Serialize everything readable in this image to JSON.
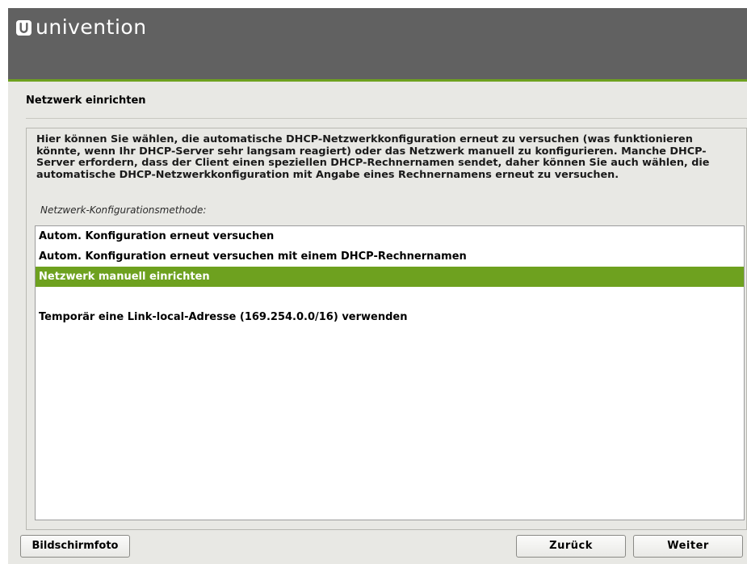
{
  "brand": {
    "name": "univention"
  },
  "page": {
    "title": "Netzwerk einrichten"
  },
  "content": {
    "description": "Hier können Sie wählen, die automatische DHCP-Netzwerkkonfiguration erneut zu versuchen (was funktionieren könnte, wenn Ihr DHCP-Server sehr langsam reagiert) oder das Netzwerk manuell zu konfigurieren. Manche DHCP-Server erfordern, dass der Client einen speziellen DHCP-Rechnernamen sendet, daher können Sie auch wählen, die automatische DHCP-Netzwerkkonfiguration mit Angabe eines Rechnernamens erneut zu versuchen.",
    "question": "Netzwerk-Konfigurationsmethode:"
  },
  "options": [
    {
      "label": "Autom. Konfiguration erneut versuchen",
      "selected": false
    },
    {
      "label": "Autom. Konfiguration erneut versuchen mit einem DHCP-Rechnernamen",
      "selected": false
    },
    {
      "label": "Netzwerk manuell einrichten",
      "selected": true
    },
    {
      "label": "",
      "selected": false
    },
    {
      "label": "Temporär eine Link-local-Adresse (169.254.0.0/16) verwenden",
      "selected": false
    }
  ],
  "buttons": {
    "screenshot": "Bildschirmfoto",
    "back": "Zurück",
    "next": "Weiter"
  },
  "colors": {
    "header_background": "#616161",
    "accent": "#6ea11f",
    "window_background": "#e8e8e4"
  }
}
